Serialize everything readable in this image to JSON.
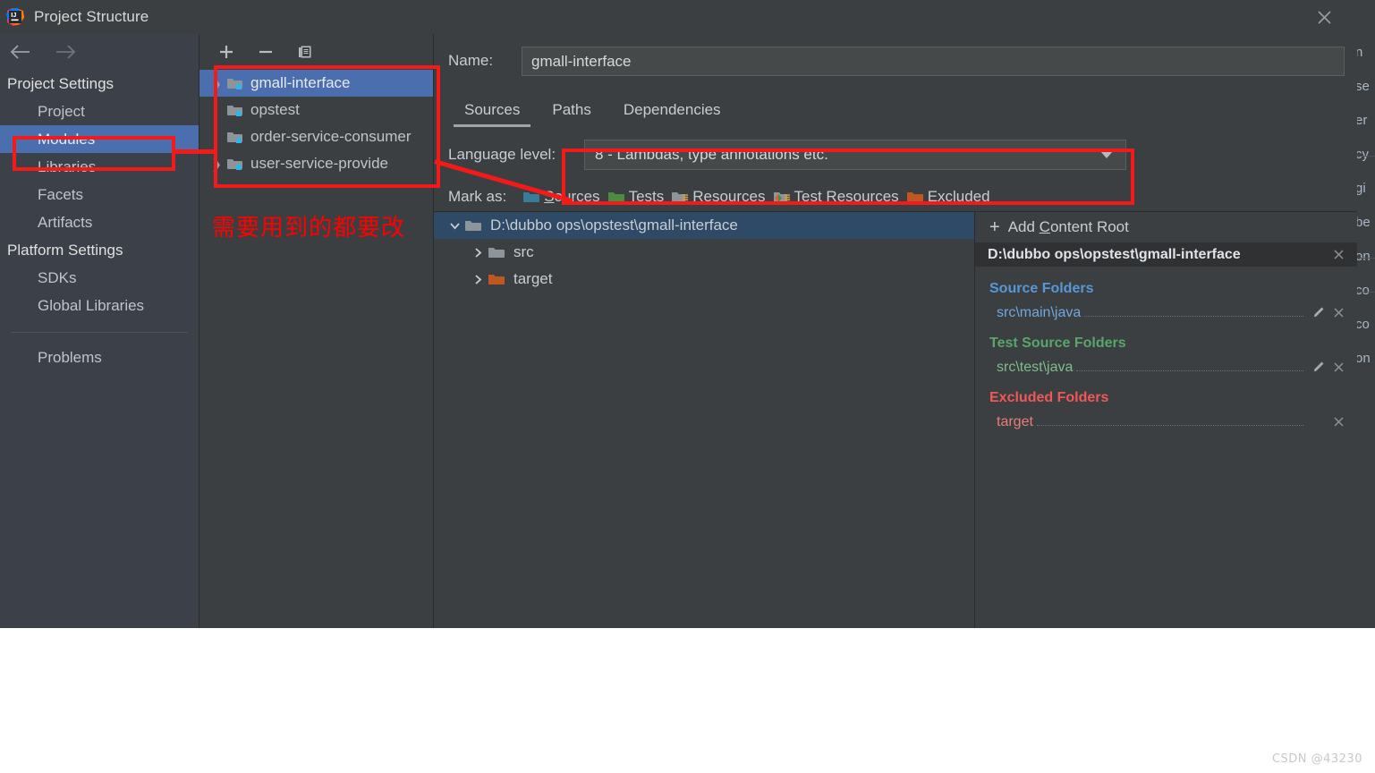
{
  "window": {
    "title": "Project Structure",
    "logo_icon": "intellij-idea-logo",
    "close_icon": "close-icon"
  },
  "nav": {
    "back_icon": "arrow-left-icon",
    "forward_icon": "arrow-right-icon"
  },
  "sidebar": {
    "groups": [
      {
        "label": "Project Settings",
        "items": [
          {
            "label": "Project",
            "selected": false
          },
          {
            "label": "Modules",
            "selected": true
          },
          {
            "label": "Libraries",
            "selected": false
          },
          {
            "label": "Facets",
            "selected": false
          },
          {
            "label": "Artifacts",
            "selected": false
          }
        ]
      },
      {
        "label": "Platform Settings",
        "items": [
          {
            "label": "SDKs",
            "selected": false
          },
          {
            "label": "Global Libraries",
            "selected": false
          }
        ]
      }
    ],
    "problems": "Problems"
  },
  "modules_panel": {
    "toolbar": [
      {
        "name": "add-module-button",
        "icon": "plus-icon"
      },
      {
        "name": "remove-module-button",
        "icon": "minus-icon"
      },
      {
        "name": "copy-module-button",
        "icon": "copy-icon"
      }
    ],
    "modules": [
      {
        "label": "gmall-interface",
        "selected": true,
        "expandable": true,
        "icon": "module-folder-icon"
      },
      {
        "label": "opstest",
        "selected": false,
        "expandable": false,
        "icon": "module-folder-icon"
      },
      {
        "label": "order-service-consumer",
        "selected": false,
        "expandable": false,
        "icon": "module-folder-icon"
      },
      {
        "label": "user-service-provide",
        "selected": false,
        "expandable": true,
        "icon": "module-folder-icon"
      }
    ],
    "annotation_cn": "需要用到的都要改"
  },
  "detail": {
    "name_label": "Name:",
    "name_value": "gmall-interface",
    "tabs": [
      {
        "label": "Sources",
        "active": true
      },
      {
        "label": "Paths",
        "active": false
      },
      {
        "label": "Dependencies",
        "active": false
      }
    ],
    "language_level_label": "Language level:",
    "language_level_value": "8 - Lambdas, type annotations etc.",
    "mark_as_label": "Mark as:",
    "mark_as_options": [
      {
        "label": "Sources",
        "mnemonic": "S",
        "color": "#3a7b9c",
        "icon": "folder-sources-icon"
      },
      {
        "label": "Tests",
        "mnemonic": "T",
        "color": "#4c8b42",
        "icon": "folder-tests-icon"
      },
      {
        "label": "Resources",
        "mnemonic": "",
        "color": "#8d949a",
        "icon": "folder-resources-icon"
      },
      {
        "label": "Test Resources",
        "mnemonic": "",
        "color": "#8d949a",
        "icon": "folder-test-resources-icon"
      },
      {
        "label": "Excluded",
        "mnemonic": "E",
        "color": "#bf5722",
        "icon": "folder-excluded-icon"
      }
    ]
  },
  "content_tree": [
    {
      "label": "D:\\dubbo ops\\opstest\\gmall-interface",
      "depth": 0,
      "selected": true,
      "expanded": true,
      "icon": "folder-grey-icon"
    },
    {
      "label": "src",
      "depth": 1,
      "selected": false,
      "expanded": false,
      "icon": "folder-grey-icon"
    },
    {
      "label": "target",
      "depth": 1,
      "selected": false,
      "expanded": false,
      "icon": "folder-excluded-icon"
    }
  ],
  "roots_panel": {
    "add_content_root": "Add Content Root",
    "add_icon": "plus-icon",
    "root_path": "D:\\dubbo ops\\opstest\\gmall-interface",
    "root_remove_icon": "close-icon",
    "groups": [
      {
        "title": "Source Folders",
        "kind": "src",
        "folders": [
          {
            "path": "src\\main\\java",
            "edit_icon": "pencil-icon",
            "remove_icon": "close-icon",
            "has_edit": true
          }
        ]
      },
      {
        "title": "Test Source Folders",
        "kind": "test",
        "folders": [
          {
            "path": "src\\test\\java",
            "edit_icon": "pencil-icon",
            "remove_icon": "close-icon",
            "has_edit": true
          }
        ]
      },
      {
        "title": "Excluded Folders",
        "kind": "excl",
        "folders": [
          {
            "path": "target",
            "edit_icon": "",
            "remove_icon": "close-icon",
            "has_edit": false
          }
        ]
      }
    ]
  },
  "background_window": {
    "cut_text_lines": [
      "n",
      "se",
      "er",
      "cy",
      "gi",
      "be",
      "on",
      "co",
      "co",
      "on"
    ]
  },
  "annotations": {
    "color": "#f41a1a",
    "boxes": [
      "modules-sidebar-highlight",
      "modules-list-highlight",
      "language-level-highlight"
    ]
  },
  "watermark": "CSDN @43230"
}
